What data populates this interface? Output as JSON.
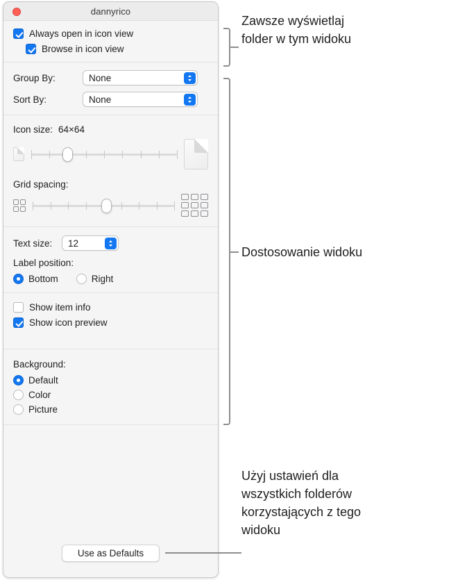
{
  "window": {
    "title": "dannyrico",
    "close_icon": "close-traffic-light-icon"
  },
  "view_options": {
    "always_open_icon_view": {
      "label": "Always open in icon view",
      "checked": true
    },
    "browse_icon_view": {
      "label": "Browse in icon view",
      "checked": true
    },
    "group_by": {
      "label": "Group By:",
      "value": "None"
    },
    "sort_by": {
      "label": "Sort By:",
      "value": "None"
    },
    "icon_size": {
      "label": "Icon size:",
      "value": "64×64",
      "slider_percent": 25,
      "ticks": 9,
      "small_icon": "small-document-icon",
      "large_icon": "large-document-icon"
    },
    "grid_spacing": {
      "label": "Grid spacing:",
      "slider_percent": 52,
      "ticks": 9,
      "small_icon": "small-grid-icon",
      "large_icon": "large-grid-icon"
    },
    "text_size": {
      "label": "Text size:",
      "value": "12"
    },
    "label_position": {
      "label": "Label position:",
      "options": [
        {
          "label": "Bottom",
          "selected": true
        },
        {
          "label": "Right",
          "selected": false
        }
      ]
    },
    "show_item_info": {
      "label": "Show item info",
      "checked": false
    },
    "show_icon_preview": {
      "label": "Show icon preview",
      "checked": true
    },
    "background": {
      "label": "Background:",
      "options": [
        {
          "label": "Default",
          "selected": true
        },
        {
          "label": "Color",
          "selected": false
        },
        {
          "label": "Picture",
          "selected": false
        }
      ]
    },
    "use_as_defaults": {
      "label": "Use as Defaults"
    }
  },
  "annotations": [
    {
      "id": "annotation-view-in-folder",
      "line1": "Zawsze wyświetlaj",
      "line2": "folder w tym widoku"
    },
    {
      "id": "annotation-customize-view",
      "line1": "Dostosowanie widoku"
    },
    {
      "id": "annotation-use-defaults",
      "line1": "Użyj ustawień dla",
      "line2": "wszystkich folderów",
      "line3": "korzystających z tego",
      "line4": "widoku"
    }
  ],
  "colors": {
    "accent": "#1277f1",
    "close": "#ff5f57",
    "callout": "#8d8d8d",
    "window_bg": "#f5f5f5"
  }
}
